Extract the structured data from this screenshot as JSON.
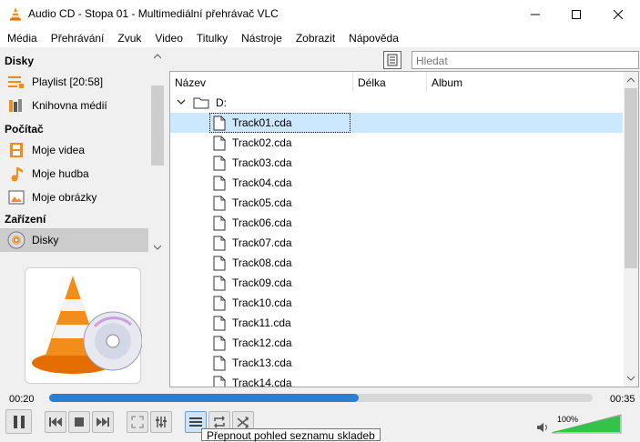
{
  "window": {
    "title": "Audio CD - Stopa 01 - Multimediální přehrávač VLC"
  },
  "menu": [
    "Média",
    "Přehrávání",
    "Zvuk",
    "Video",
    "Titulky",
    "Nástroje",
    "Zobrazit",
    "Nápověda"
  ],
  "sidebar": {
    "sections": [
      {
        "header": "Disky",
        "items": [
          {
            "label": "Playlist [20:58]",
            "icon": "playlist-icon"
          },
          {
            "label": "Knihovna médií",
            "icon": "media-library-icon"
          }
        ]
      },
      {
        "header": "Počítač",
        "items": [
          {
            "label": "Moje videa",
            "icon": "film-icon"
          },
          {
            "label": "Moje hudba",
            "icon": "music-note-icon"
          },
          {
            "label": "Moje obrázky",
            "icon": "picture-icon"
          }
        ]
      },
      {
        "header": "Zařízení",
        "items": [
          {
            "label": "Disky",
            "icon": "disc-icon",
            "selected": true
          }
        ]
      }
    ]
  },
  "search": {
    "placeholder": "Hledat"
  },
  "list": {
    "columns": [
      "Název",
      "Délka",
      "Album"
    ],
    "folder": "D:",
    "tracks": [
      "Track01.cda",
      "Track02.cda",
      "Track03.cda",
      "Track04.cda",
      "Track05.cda",
      "Track06.cda",
      "Track07.cda",
      "Track08.cda",
      "Track09.cda",
      "Track10.cda",
      "Track11.cda",
      "Track12.cda",
      "Track13.cda",
      "Track14.cda"
    ],
    "selected_index": 0
  },
  "player": {
    "time_current": "00:20",
    "time_total": "00:35",
    "progress": 0.57,
    "volume_label": "100%",
    "volume": 1.0
  },
  "tooltip": "Přepnout pohled seznamu skladeb",
  "colors": {
    "accent": "#2f7dcf",
    "selection": "#cce8ff",
    "vlc_orange": "#f28c1a",
    "volume_green": "#33c24a"
  }
}
